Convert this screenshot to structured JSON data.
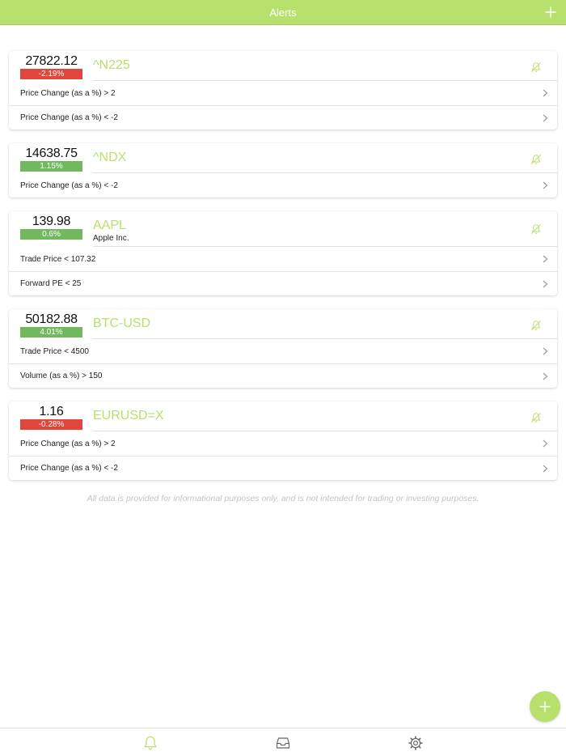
{
  "colors": {
    "accent": "#b8e06d",
    "negative": "#e0463b",
    "positive": "#72b85f"
  },
  "navbar": {
    "title": "Alerts",
    "add_icon": "plus-icon"
  },
  "alerts": [
    {
      "price": "27822.12",
      "change": "-2.19%",
      "direction": "negative",
      "symbol": "^N225",
      "company": "",
      "rules": [
        "Price Change (as a %) > 2",
        "Price Change (as a %) < -2"
      ]
    },
    {
      "price": "14638.75",
      "change": "1.15%",
      "direction": "positive",
      "symbol": "^NDX",
      "company": "",
      "rules": [
        "Price Change (as a %) < -2"
      ]
    },
    {
      "price": "139.98",
      "change": "0.6%",
      "direction": "positive",
      "symbol": "AAPL",
      "company": "Apple Inc.",
      "rules": [
        "Trade Price < 107.32",
        "Forward PE < 25"
      ]
    },
    {
      "price": "50182.88",
      "change": "4.01%",
      "direction": "positive",
      "symbol": "BTC-USD",
      "company": "",
      "rules": [
        "Trade Price < 4500",
        "Volume (as a %) > 150"
      ]
    },
    {
      "price": "1.16",
      "change": "-0.28%",
      "direction": "negative",
      "symbol": "EURUSD=X",
      "company": "",
      "rules": [
        "Price Change (as a %) > 2",
        "Price Change (as a %) < -2"
      ]
    }
  ],
  "disclaimer": "All data is provided for informational purposes only, and is not intended for trading or investing purposes.",
  "tabs": [
    {
      "name": "alerts",
      "icon": "bell-icon",
      "active": true
    },
    {
      "name": "inbox",
      "icon": "inbox-icon",
      "active": false
    },
    {
      "name": "settings",
      "icon": "gear-icon",
      "active": false
    }
  ]
}
